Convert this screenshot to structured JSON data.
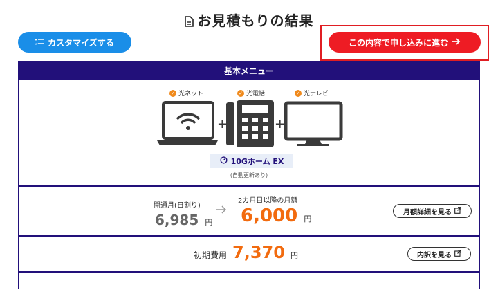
{
  "page": {
    "title": "お見積もりの結果"
  },
  "toolbar": {
    "customize_label": "カスタマイズする",
    "apply_label": "この内容で申し込みに進む"
  },
  "menu": {
    "header": "基本メニュー",
    "services": [
      "光ネット",
      "光電話",
      "光テレビ"
    ],
    "plan_name": "10Gホーム EX",
    "plan_note": "(自動更新あり)"
  },
  "pricing": {
    "first_month_label": "開通月(日割り)",
    "first_month_amount": "6,985",
    "from_second_label": "2カ月目以降の月額",
    "from_second_amount": "6,000",
    "currency": "円",
    "monthly_detail_label": "月額詳細を見る",
    "initial_cost_label": "初期費用",
    "initial_cost_amount": "7,370",
    "breakdown_label": "内訳を見る"
  },
  "colors": {
    "brand_navy": "#22107a",
    "accent_blue": "#1a8ee8",
    "accent_red": "#ee1c24",
    "price_orange": "#f26b0f",
    "check_orange": "#f08a1c"
  }
}
